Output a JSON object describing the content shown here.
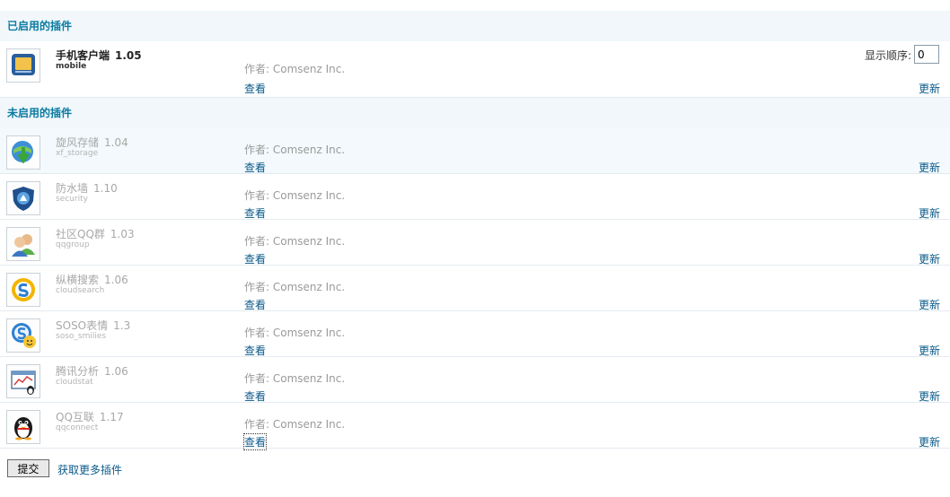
{
  "enabled_section": {
    "title": "已启用的插件"
  },
  "disabled_section": {
    "title": "未启用的插件"
  },
  "labels": {
    "view": "查看",
    "update": "更新",
    "display_order": "显示顺序:"
  },
  "enabled_plugins": [
    {
      "name": "手机客户端",
      "version": "1.05",
      "ident": "mobile",
      "author": "作者: Comsenz Inc.",
      "order": "0",
      "icon": "mobile-client-icon"
    }
  ],
  "disabled_plugins": [
    {
      "name": "旋风存储",
      "version": "1.04",
      "ident": "xf_storage",
      "author": "作者: Comsenz Inc.",
      "icon": "storage-icon"
    },
    {
      "name": "防水墙",
      "version": "1.10",
      "ident": "security",
      "author": "作者: Comsenz Inc.",
      "icon": "security-shield-icon"
    },
    {
      "name": "社区QQ群",
      "version": "1.03",
      "ident": "qqgroup",
      "author": "作者: Comsenz Inc.",
      "icon": "qq-group-icon"
    },
    {
      "name": "纵横搜索",
      "version": "1.06",
      "ident": "cloudsearch",
      "author": "作者: Comsenz Inc.",
      "icon": "cloud-search-icon"
    },
    {
      "name": "SOSO表情",
      "version": "1.3",
      "ident": "soso_smilies",
      "author": "作者: Comsenz Inc.",
      "icon": "soso-smilies-icon"
    },
    {
      "name": "腾讯分析",
      "version": "1.06",
      "ident": "cloudstat",
      "author": "作者: Comsenz Inc.",
      "icon": "cloud-stat-icon"
    },
    {
      "name": "QQ互联",
      "version": "1.17",
      "ident": "qqconnect",
      "author": "作者: Comsenz Inc.",
      "icon": "qq-penguin-icon"
    }
  ],
  "footer": {
    "submit_label": "提交",
    "more_link": "获取更多插件"
  },
  "colors": {
    "section_title": "#0a7ba0",
    "link": "#0a5a8a",
    "section_bg": "#f1f7fb"
  }
}
